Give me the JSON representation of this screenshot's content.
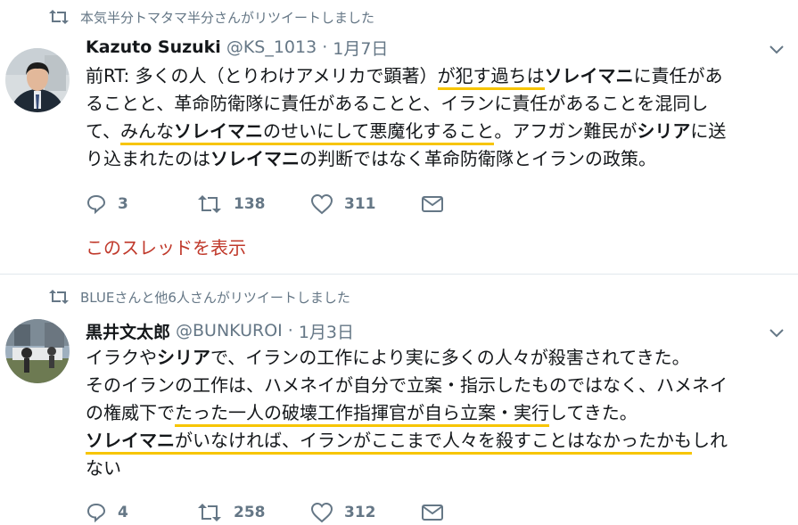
{
  "tweets": [
    {
      "retweeted_by": "本気半分トマタマ半分さんがリツイートしました",
      "author": {
        "name": "Kazuto Suzuki",
        "handle": "@KS_1013",
        "date": "1月7日"
      },
      "separator": "·",
      "lines": [
        [
          {
            "t": "前RT: 多くの人（とりわけアメリカで顕著）"
          },
          {
            "t": "が犯す過ち",
            "hl": true
          },
          {
            "t": "は",
            "hl": true
          },
          {
            "t": "ソレイマニ",
            "bold": true
          },
          {
            "t": "に責任があ"
          }
        ],
        [
          {
            "t": "ることと、革命防衛隊に責任があることと、イランに責任があることを混同し"
          }
        ],
        [
          {
            "t": "て、"
          },
          {
            "t": "みんな",
            "hl": true
          },
          {
            "t": "ソレイマニ",
            "bold": true,
            "hl": true
          },
          {
            "t": "のせいにして悪魔化すること",
            "hl": true
          },
          {
            "t": "。アフガン難民が"
          },
          {
            "t": "シリア",
            "bold": true
          },
          {
            "t": "に送"
          }
        ],
        [
          {
            "t": "り込まれたのは"
          },
          {
            "t": "ソレイマニ",
            "bold": true
          },
          {
            "t": "の判断ではなく革命防衛隊とイランの政策。"
          }
        ]
      ],
      "actions": {
        "reply": "3",
        "retweet": "138",
        "like": "311"
      },
      "thread_link": "このスレッドを表示"
    },
    {
      "retweeted_by": "BLUEさんと他6人さんがリツイートしました",
      "author": {
        "name": "黒井文太郎",
        "handle": "@BUNKUROI",
        "date": "1月3日"
      },
      "separator": "·",
      "lines": [
        [
          {
            "t": "イラクや"
          },
          {
            "t": "シリア",
            "bold": true
          },
          {
            "t": "で、イランの工作により実に多くの人々が殺害されてきた。"
          }
        ],
        [
          {
            "t": "そのイランの工作は、ハメネイが自分で立案・指示したものではなく、ハメネイ"
          }
        ],
        [
          {
            "t": "の権威下で"
          },
          {
            "t": "たった一人の破壊工作指揮官が自ら立案・実行",
            "hl": true
          },
          {
            "t": "してきた。"
          }
        ],
        [
          {
            "t": "ソレイマニ",
            "bold": true,
            "hl": true
          },
          {
            "t": "がいなければ、イランがここまで人々を殺すことはなかったかも",
            "hl": true
          },
          {
            "t": "しれ"
          }
        ],
        [
          {
            "t": "ない"
          }
        ]
      ],
      "actions": {
        "reply": "4",
        "retweet": "258",
        "like": "312"
      }
    }
  ],
  "colors": {
    "accent": "#f7c500",
    "muted": "#657786",
    "thread_link": "#c0392b",
    "divider": "#e1e8ed"
  },
  "icons": [
    "retweet-icon",
    "reply-icon",
    "like-icon",
    "message-icon",
    "chevron-down-icon"
  ]
}
